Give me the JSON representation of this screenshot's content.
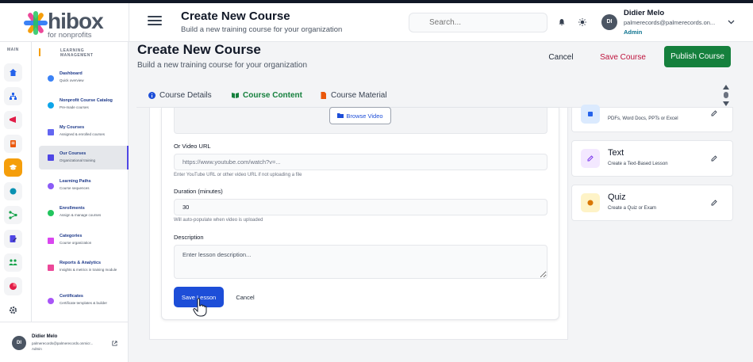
{
  "app": {
    "logo_word": "hibox",
    "logo_sub": "for nonprofits"
  },
  "header": {
    "title": "Create New Course",
    "subtitle": "Build a new training course for your organization",
    "search_placeholder": "Search...",
    "user_name": "Didier Melo",
    "user_email": "palmerecords@palmerecords.on...",
    "user_role": "Admin",
    "avatar_initials": "DI"
  },
  "rail": {
    "label": "MAIN"
  },
  "nav": {
    "heading": "LEARNING MANAGEMENT",
    "items": [
      {
        "title": "Dashboard",
        "sub": "Quick overview",
        "color": "#3b82f6"
      },
      {
        "title": "Nonprofit Course Catalog",
        "sub": "Pre-made courses",
        "color": "#0ea5e9"
      },
      {
        "title": "My Courses",
        "sub": "Assigned & enrolled courses",
        "color": "#6366f1"
      },
      {
        "title": "Our Courses",
        "sub": "Organizational training",
        "color": "#4f46e5"
      },
      {
        "title": "Learning Paths",
        "sub": "Course sequences",
        "color": "#8b5cf6"
      },
      {
        "title": "Enrollments",
        "sub": "Assign & manage courses",
        "color": "#22c55e"
      },
      {
        "title": "Categories",
        "sub": "Course organization",
        "color": "#d946ef"
      },
      {
        "title": "Reports & Analytics",
        "sub": "Insights & metrics in training module",
        "color": "#ec4899"
      },
      {
        "title": "Certificates",
        "sub": "Certificate templates & builder",
        "color": "#a855f7"
      }
    ],
    "user_name": "Didier Melo",
    "user_email": "palmerecords@palmerecords.onmicr...",
    "user_role": "Admin",
    "avatar_initials": "DI"
  },
  "page": {
    "title": "Create New Course",
    "subtitle": "Build a new training course for your organization",
    "cancel_label": "Cancel",
    "save_label": "Save Course",
    "publish_label": "Publish Course"
  },
  "tabs": [
    {
      "label": "Course Details",
      "active": false
    },
    {
      "label": "Course Content",
      "active": true
    },
    {
      "label": "Course Material",
      "active": false
    }
  ],
  "form": {
    "browse_label": "Browse Video",
    "video_url_label": "Or Video URL",
    "video_url_placeholder": "https://www.youtube.com/watch?v=...",
    "video_url_hint": "Enter YouTube URL or other video URL if not uploading a file",
    "duration_label": "Duration (minutes)",
    "duration_value": "30",
    "duration_hint": "Will auto-populate when video is uploaded",
    "description_label": "Description",
    "description_placeholder": "Enter lesson description...",
    "save_lesson_label": "Save Lesson",
    "cancel_label": "Cancel"
  },
  "lesson_types": [
    {
      "title": "",
      "desc": "PDFs, Word Docs, PPTs or Excel",
      "icon": "document-icon",
      "color": "#dbeafe"
    },
    {
      "title": "Text",
      "desc": "Create a Text-Based Lesson",
      "icon": "text-icon",
      "color": "#f3e8ff"
    },
    {
      "title": "Quiz",
      "desc": "Create a Quiz or Exam",
      "icon": "quiz-icon",
      "color": "#fef3c7"
    }
  ]
}
